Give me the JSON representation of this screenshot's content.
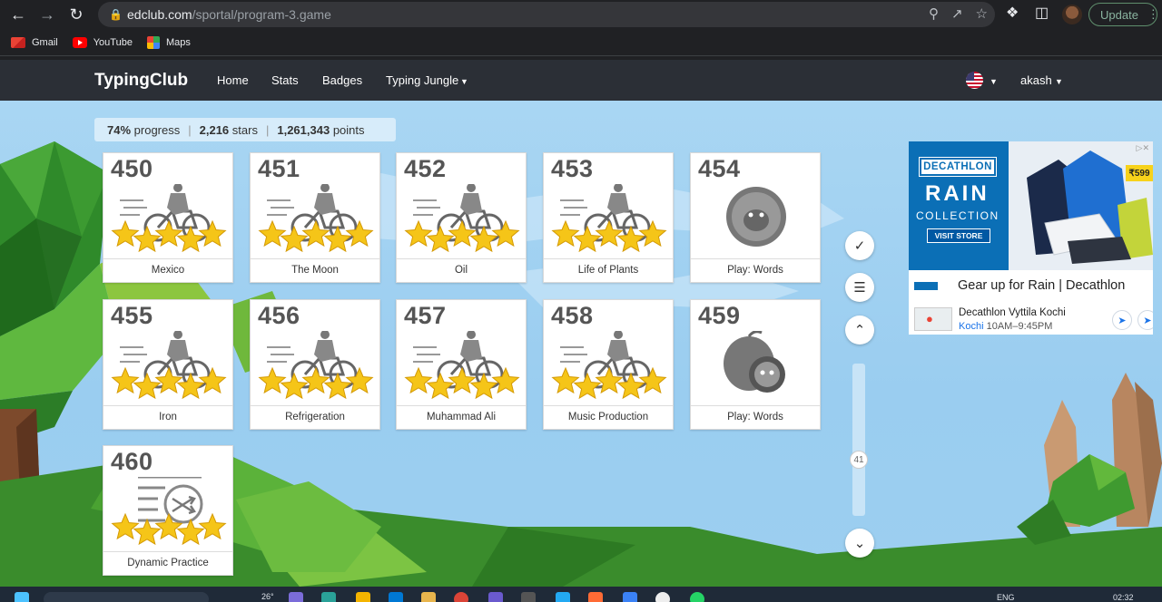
{
  "browser": {
    "url_host": "edclub.com",
    "url_path": "/sportal/program-3.game",
    "update_label": "Update",
    "bookmarks": [
      {
        "label": "Gmail",
        "icon": "gmail-icon"
      },
      {
        "label": "YouTube",
        "icon": "youtube-icon"
      },
      {
        "label": "Maps",
        "icon": "maps-icon"
      }
    ]
  },
  "header": {
    "logo": "TypingClub",
    "nav": [
      "Home",
      "Stats",
      "Badges",
      "Typing Jungle"
    ],
    "user": "akash"
  },
  "progress": {
    "percent": "74%",
    "percent_label": "progress",
    "stars": "2,216",
    "stars_label": "stars",
    "points": "1,261,343",
    "points_label": "points"
  },
  "lessons": [
    {
      "num": "450",
      "title": "Mexico",
      "icon": "bike-icon",
      "stars": 5
    },
    {
      "num": "451",
      "title": "The Moon",
      "icon": "bike-icon",
      "stars": 5
    },
    {
      "num": "452",
      "title": "Oil",
      "icon": "bike-icon",
      "stars": 5
    },
    {
      "num": "453",
      "title": "Life of Plants",
      "icon": "bike-icon",
      "stars": 5
    },
    {
      "num": "454",
      "title": "Play: Words",
      "icon": "game-bubble-icon",
      "stars": 0
    },
    {
      "num": "455",
      "title": "Iron",
      "icon": "bike-icon",
      "stars": 5
    },
    {
      "num": "456",
      "title": "Refrigeration",
      "icon": "bike-icon",
      "stars": 5
    },
    {
      "num": "457",
      "title": "Muhammad Ali",
      "icon": "bike-icon",
      "stars": 5
    },
    {
      "num": "458",
      "title": "Music Production",
      "icon": "bike-icon",
      "stars": 5
    },
    {
      "num": "459",
      "title": "Play: Words",
      "icon": "game-apple-icon",
      "stars": 0
    },
    {
      "num": "460",
      "title": "Dynamic Practice",
      "icon": "shuffle-list-icon",
      "stars": 5
    }
  ],
  "scroll": {
    "position_label": "41"
  },
  "ad": {
    "brand": "DECATHLON",
    "rain": "RAIN",
    "collection": "COLLECTION",
    "visit": "VISIT STORE",
    "price": "₹599",
    "headline": "Gear up for Rain | Decathlon",
    "store": "Decathlon Vyttila Kochi",
    "city": "Kochi",
    "hours": "10AM–9:45PM"
  },
  "taskbar": {
    "temp": "26°",
    "lang": "ENG",
    "time": "02:32"
  },
  "colors": {
    "header_bg": "#2b2f36",
    "sky": "#9acdf0",
    "star": "#f5c518",
    "decathlon_blue": "#0b6fb6"
  }
}
